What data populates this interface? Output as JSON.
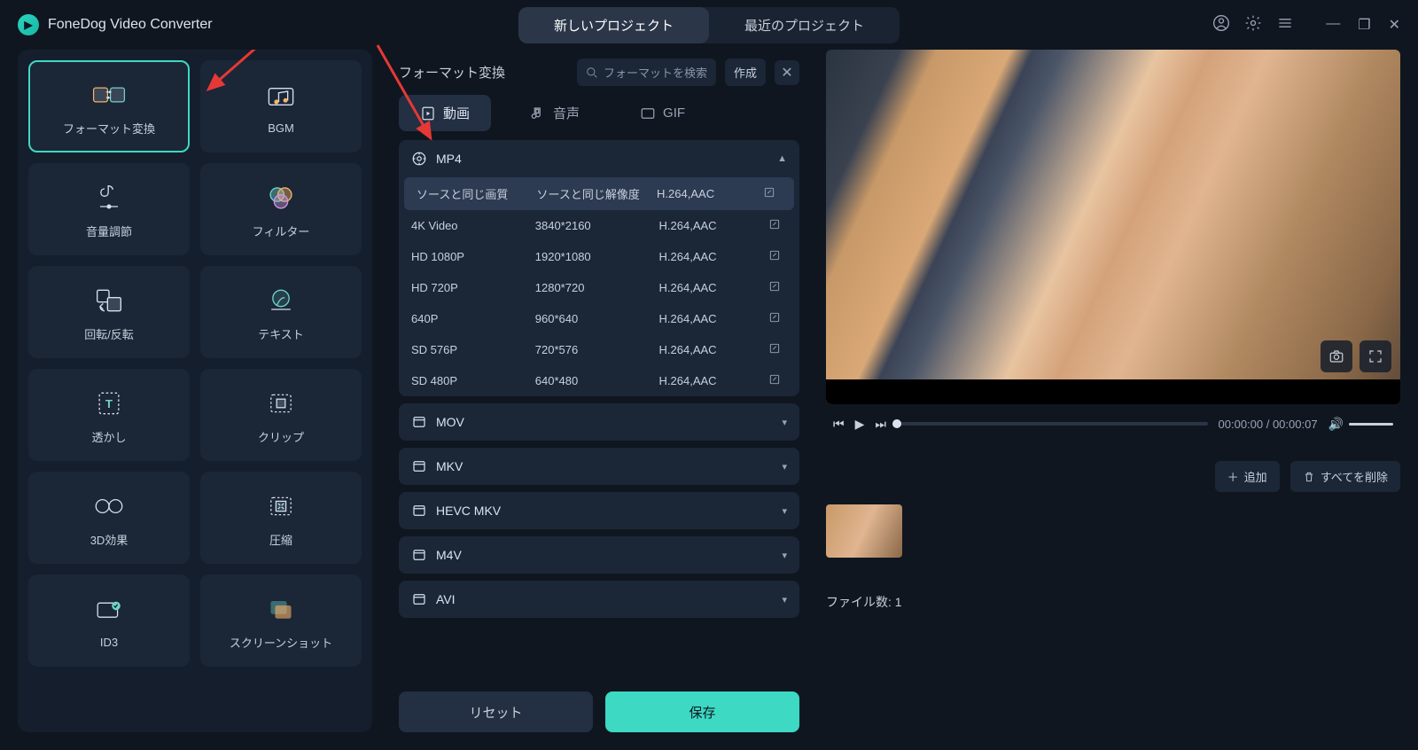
{
  "app": {
    "title": "FoneDog Video Converter"
  },
  "topTabs": {
    "new": "新しいプロジェクト",
    "recent": "最近のプロジェクト"
  },
  "tools": [
    {
      "label": "フォーマット変換",
      "icon": "convert",
      "selected": true
    },
    {
      "label": "BGM",
      "icon": "bgm"
    },
    {
      "label": "音量調節",
      "icon": "volume"
    },
    {
      "label": "フィルター",
      "icon": "filter"
    },
    {
      "label": "回転/反転",
      "icon": "rotate"
    },
    {
      "label": "テキスト",
      "icon": "text"
    },
    {
      "label": "透かし",
      "icon": "watermark"
    },
    {
      "label": "クリップ",
      "icon": "clip"
    },
    {
      "label": "3D効果",
      "icon": "3d"
    },
    {
      "label": "圧縮",
      "icon": "compress"
    },
    {
      "label": "ID3",
      "icon": "id3"
    },
    {
      "label": "スクリーンショット",
      "icon": "screenshot"
    }
  ],
  "center": {
    "title": "フォーマット変換",
    "searchPlaceholder": "フォーマットを検索",
    "createBtn": "作成",
    "typeTabs": {
      "video": "動画",
      "audio": "音声",
      "gif": "GIF"
    },
    "mp4": {
      "name": "MP4",
      "specs": [
        {
          "q": "ソースと同じ画質",
          "res": "ソースと同じ解像度",
          "codec": "H.264,AAC",
          "selected": true
        },
        {
          "q": "4K Video",
          "res": "3840*2160",
          "codec": "H.264,AAC"
        },
        {
          "q": "HD 1080P",
          "res": "1920*1080",
          "codec": "H.264,AAC"
        },
        {
          "q": "HD 720P",
          "res": "1280*720",
          "codec": "H.264,AAC"
        },
        {
          "q": "640P",
          "res": "960*640",
          "codec": "H.264,AAC"
        },
        {
          "q": "SD 576P",
          "res": "720*576",
          "codec": "H.264,AAC"
        },
        {
          "q": "SD 480P",
          "res": "640*480",
          "codec": "H.264,AAC"
        }
      ]
    },
    "others": [
      "MOV",
      "MKV",
      "HEVC MKV",
      "M4V",
      "AVI"
    ],
    "reset": "リセット",
    "save": "保存"
  },
  "preview": {
    "time": "00:00:00 / 00:00:07",
    "addBtn": "追加",
    "deleteAllBtn": "すべてを削除",
    "fileCountLabel": "ファイル数:",
    "fileCount": "1"
  }
}
